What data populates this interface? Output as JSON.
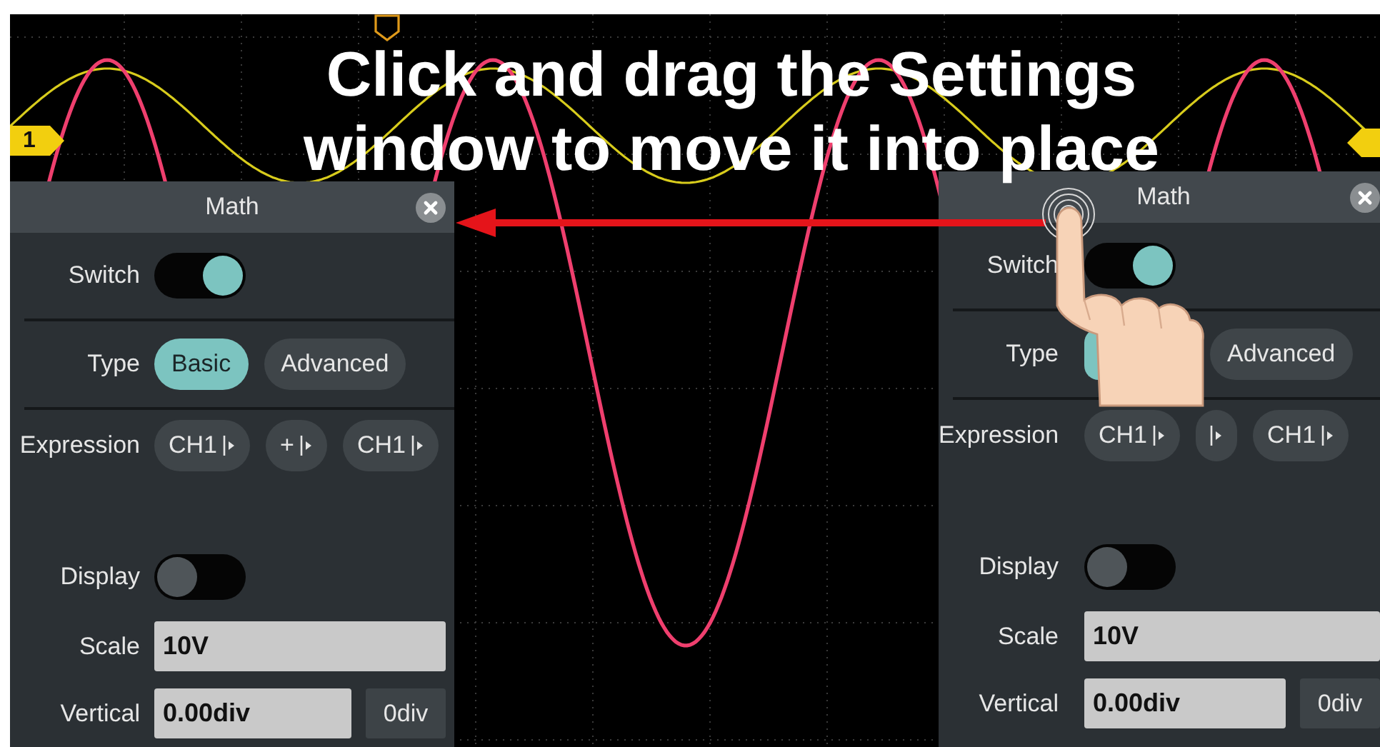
{
  "caption": {
    "lines": [
      "Click and drag the Settings",
      "window to move it into place"
    ]
  },
  "channel_marker": {
    "label": "1"
  },
  "panels": [
    {
      "title": "Math",
      "rows": [
        {
          "kind": "switch",
          "label": "Switch",
          "on": true
        },
        {
          "kind": "choice",
          "label": "Type",
          "options": [
            {
              "label": "Basic",
              "selected": true
            },
            {
              "label": "Advanced",
              "selected": false
            }
          ]
        },
        {
          "kind": "chips",
          "label": "Expression",
          "chips": [
            {
              "kind": "operand",
              "label": "CH1"
            },
            {
              "kind": "operand",
              "label": "+"
            },
            {
              "kind": "operand",
              "label": "CH1"
            }
          ]
        },
        {
          "kind": "switch",
          "label": "Display",
          "on": false
        },
        {
          "kind": "field",
          "label": "Scale",
          "value": "10V"
        },
        {
          "kind": "field",
          "label": "Vertical",
          "value": "0.00div",
          "button": "0div"
        }
      ]
    },
    {
      "title": "Math",
      "rows": [
        {
          "kind": "switch",
          "label": "Switch",
          "on": true
        },
        {
          "kind": "choice",
          "label": "Type",
          "options": [
            {
              "selected": true
            },
            {
              "label": "Advanced",
              "selected": false
            }
          ]
        },
        {
          "kind": "chips",
          "label": "Expression",
          "chips": [
            {
              "kind": "operand",
              "label": "CH1"
            },
            {
              "kind": "operand"
            },
            {
              "kind": "operand",
              "label": "CH1"
            }
          ]
        },
        {
          "kind": "switch",
          "label": "Display",
          "on": false
        },
        {
          "kind": "field",
          "label": "Scale",
          "value": "10V"
        },
        {
          "kind": "field",
          "label": "Vertical",
          "value": "0.00div",
          "button": "0div"
        }
      ]
    }
  ]
}
